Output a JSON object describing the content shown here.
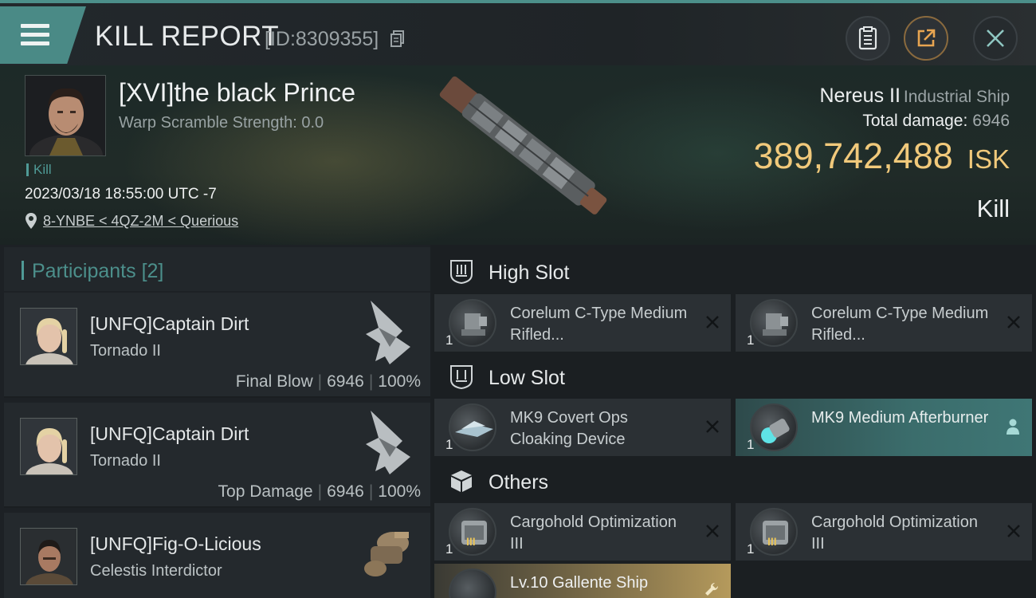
{
  "header": {
    "title": "KILL REPORT",
    "report_id": "[ID:8309355]"
  },
  "victim": {
    "name": "[XVI]the black Prince",
    "warp_scramble": "Warp Scramble Strength: 0.0",
    "kill_tag": "Kill",
    "datetime": "2023/03/18 18:55:00 UTC -7",
    "location": "8-YNBE < 4QZ-2M < Querious",
    "ship_name": "Nereus II",
    "ship_class": "Industrial Ship",
    "total_damage_label": "Total damage:",
    "total_damage": "6946",
    "isk_value": "389,742,488",
    "isk_unit": "ISK",
    "result": "Kill"
  },
  "participants": {
    "label": "Participants",
    "count": "[2]",
    "rows": [
      {
        "name": "[UNFQ]Captain Dirt",
        "ship": "Tornado II",
        "role": "Final Blow",
        "damage": "6946",
        "percent": "100%"
      },
      {
        "name": "[UNFQ]Captain Dirt",
        "ship": "Tornado II",
        "role": "Top Damage",
        "damage": "6946",
        "percent": "100%"
      },
      {
        "name": "[UNFQ]Fig-O-Licious",
        "ship": "Celestis Interdictor"
      }
    ]
  },
  "fitting": {
    "high_slot": {
      "title": "High Slot",
      "modules": [
        {
          "qty": "1",
          "name": "Corelum C-Type Medium Rifled...",
          "icon": "turret-icon"
        },
        {
          "qty": "1",
          "name": "Corelum C-Type Medium Rifled...",
          "icon": "turret-icon"
        }
      ]
    },
    "low_slot": {
      "title": "Low Slot",
      "modules": [
        {
          "qty": "1",
          "name": "MK9 Covert Ops Cloaking Device",
          "icon": "cloak-icon"
        },
        {
          "qty": "1",
          "name": "MK9 Medium Afterburner",
          "icon": "afterburner-icon"
        }
      ]
    },
    "others": {
      "title": "Others",
      "modules": [
        {
          "qty": "1",
          "name": "Cargohold Optimization III",
          "icon": "cargohold-icon"
        },
        {
          "qty": "1",
          "name": "Cargohold Optimization III",
          "icon": "cargohold-icon"
        },
        {
          "name": "Lv.10 Gallente Ship"
        }
      ]
    }
  },
  "colors": {
    "accent": "#4c8f8a",
    "isk_gold": "#f1c97b",
    "highlight_module": "#3b6d6c",
    "gold_module": "#b59a5c"
  }
}
